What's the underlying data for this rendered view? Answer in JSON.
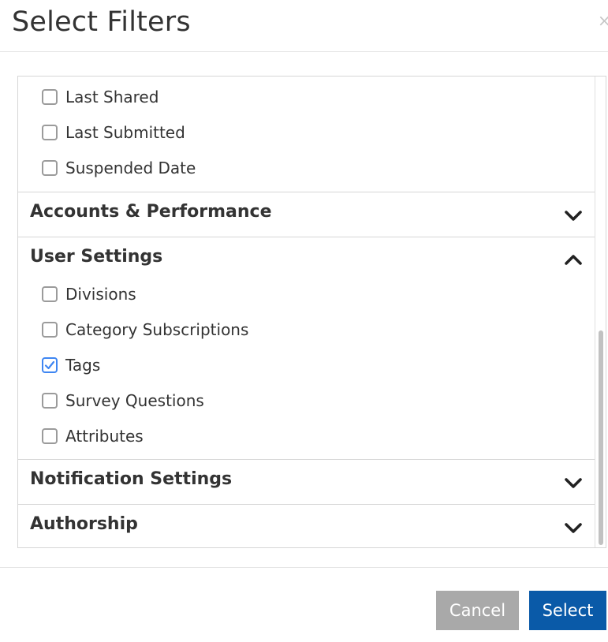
{
  "dialog": {
    "title": "Select Filters",
    "close_glyph": "×"
  },
  "top_options": [
    {
      "label": "Last Shared",
      "checked": false
    },
    {
      "label": "Last Submitted",
      "checked": false
    },
    {
      "label": "Suspended Date",
      "checked": false
    }
  ],
  "sections": {
    "accounts": {
      "title": "Accounts & Performance",
      "expanded": false,
      "icon": "chevron-down-icon"
    },
    "user_settings": {
      "title": "User Settings",
      "expanded": true,
      "icon": "chevron-up-icon",
      "options": [
        {
          "label": "Divisions",
          "checked": false
        },
        {
          "label": "Category Subscriptions",
          "checked": false
        },
        {
          "label": "Tags",
          "checked": true
        },
        {
          "label": "Survey Questions",
          "checked": false
        },
        {
          "label": "Attributes",
          "checked": false
        }
      ]
    },
    "notifications": {
      "title": "Notification Settings",
      "expanded": false,
      "icon": "chevron-down-icon"
    },
    "authorship": {
      "title": "Authorship",
      "expanded": false,
      "icon": "chevron-down-icon"
    }
  },
  "footer": {
    "cancel_label": "Cancel",
    "select_label": "Select"
  },
  "colors": {
    "primary": "#0a5aa8",
    "cancel": "#a9a9a9",
    "check": "#3f86f2"
  }
}
